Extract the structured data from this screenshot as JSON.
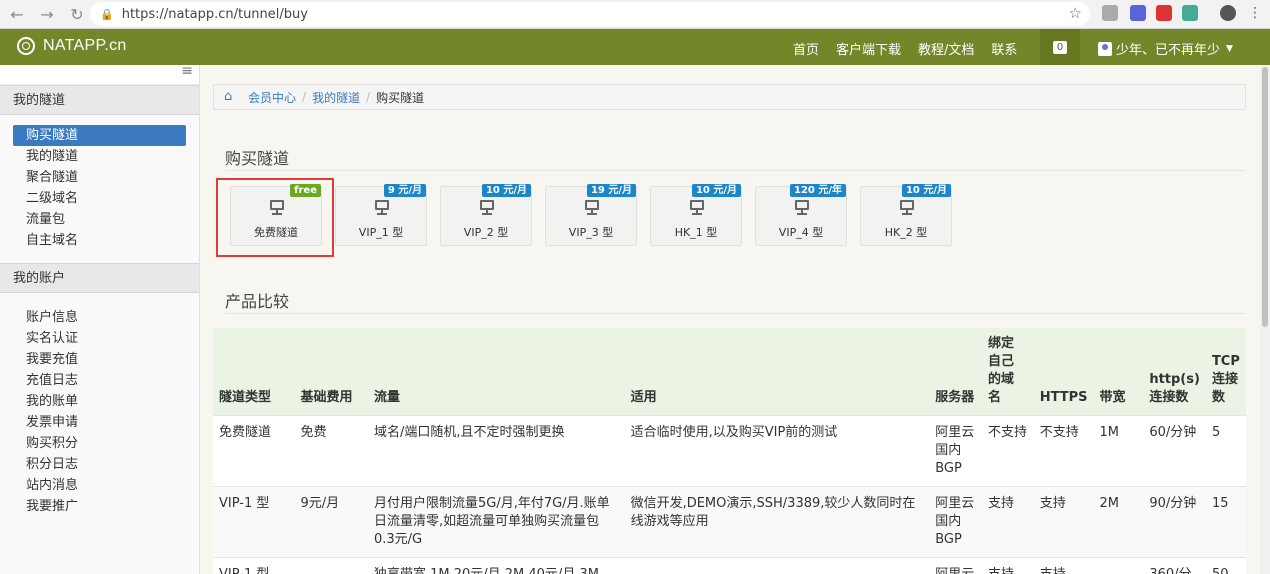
{
  "browser": {
    "url": "https://natapp.cn/tunnel/buy",
    "back_icon": "arrow-left",
    "forward_icon": "arrow-right",
    "reload_icon": "reload"
  },
  "header": {
    "logo_text": "NATAPP.cn",
    "nav": [
      "首页",
      "客户端下载",
      "教程/文档",
      "联系"
    ],
    "message_count": "0",
    "user_name": "少年、已不再年少",
    "bg_color": "#74862a"
  },
  "sidebar": {
    "sections": [
      {
        "title": "我的隧道",
        "items": [
          "购买隧道",
          "我的隧道",
          "聚合隧道",
          "二级域名",
          "流量包",
          "自主域名"
        ],
        "active_index": 0
      },
      {
        "title": "我的账户",
        "items": [
          "账户信息",
          "实名认证",
          "我要充值",
          "充值日志",
          "我的账单",
          "发票申请",
          "购买积分",
          "积分日志",
          "站内消息",
          "我要推广"
        ]
      }
    ]
  },
  "breadcrumb": [
    "会员中心",
    "我的隧道",
    "购买隧道"
  ],
  "buy_title": "购买隧道",
  "tiles": [
    {
      "label": "免费隧道",
      "price": "free"
    },
    {
      "label": "VIP_1 型",
      "price": "9 元/月"
    },
    {
      "label": "VIP_2 型",
      "price": "10 元/月"
    },
    {
      "label": "VIP_3 型",
      "price": "19 元/月"
    },
    {
      "label": "HK_1 型",
      "price": "10 元/月"
    },
    {
      "label": "VIP_4 型",
      "price": "120 元/年"
    },
    {
      "label": "HK_2 型",
      "price": "10 元/月"
    }
  ],
  "compare_title": "产品比较",
  "table": {
    "headers": [
      "隧道类型",
      "基础费用",
      "流量",
      "适用",
      "服务器",
      "绑定自己的域名",
      "HTTPS",
      "带宽",
      "http(s)连接数",
      "TCP连接数"
    ],
    "header_lines": [
      [
        "隧道类型"
      ],
      [
        "基础费用"
      ],
      [
        "流量"
      ],
      [
        "适用"
      ],
      [
        "服务器"
      ],
      [
        "绑定",
        "自己",
        "的域",
        "名"
      ],
      [
        "HTTPS"
      ],
      [
        "带宽"
      ],
      [
        "http(s)",
        "连接数"
      ],
      [
        "TCP",
        "连接",
        "数"
      ]
    ],
    "rows": [
      [
        "免费隧道",
        "免费",
        "域名/端口随机,且不定时强制更换",
        "适合临时使用,以及购买VIP前的测试",
        "阿里云国内BGP",
        "不支持",
        "不支持",
        "1M",
        "60/分钟",
        "5"
      ],
      [
        "VIP-1 型",
        "9元/月",
        "月付用户限制流量5G/月,年付7G/月.账单日流量清零,如超流量可单独购买流量包0.3元/G",
        "微信开发,DEMO演示,SSH/3389,较少人数同时在线游戏等应用",
        "阿里云国内BGP",
        "支持",
        "支持",
        "2M",
        "90/分钟",
        "15"
      ],
      [
        "VIP-1 型",
        "",
        "独享带宽 1M 20元/月,2M 40元/月,3M",
        "",
        "阿里云",
        "支持",
        "支持",
        "",
        "360/分",
        "50"
      ]
    ]
  }
}
